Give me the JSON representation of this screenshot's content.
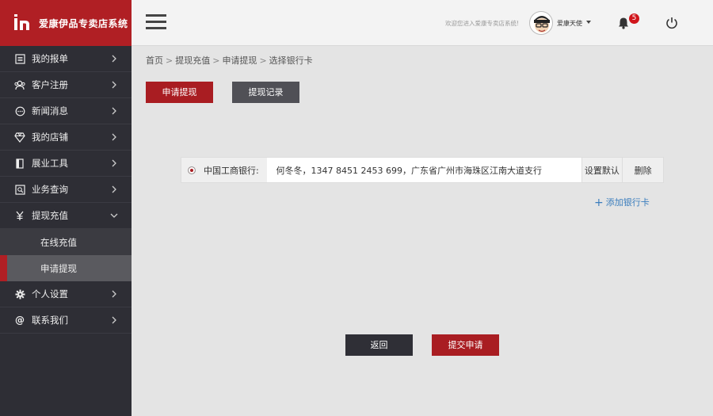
{
  "brand": {
    "name": "爱康伊品专卖店系统",
    "color": "#b01f24"
  },
  "header": {
    "welcome": "欢迎您进入爱康专卖店系统!",
    "username": "爱康天使",
    "notification_count": "5"
  },
  "sidebar": {
    "items": [
      {
        "label": "我的报单",
        "icon": "list-icon"
      },
      {
        "label": "客户注册",
        "icon": "users-icon"
      },
      {
        "label": "新闻消息",
        "icon": "message-icon"
      },
      {
        "label": "我的店铺",
        "icon": "diamond-icon"
      },
      {
        "label": "展业工具",
        "icon": "book-icon"
      },
      {
        "label": "业务查询",
        "icon": "query-icon"
      },
      {
        "label": "提现充值",
        "icon": "yuan-icon",
        "expanded": true,
        "children": [
          {
            "label": "在线充值"
          },
          {
            "label": "申请提现",
            "active": true
          }
        ]
      },
      {
        "label": "个人设置",
        "icon": "gear-icon"
      },
      {
        "label": "联系我们",
        "icon": "at-icon"
      }
    ]
  },
  "breadcrumb": [
    "首页",
    "提现充值",
    "申请提现",
    "选择银行卡"
  ],
  "tabs": {
    "apply": "申请提现",
    "records": "提现记录"
  },
  "bank_card": {
    "bank": "中国工商银行:",
    "info": "何冬冬，1347 8451 2453 699，广东省广州市海珠区江南大道支行",
    "set_default": "设置默认",
    "delete": "删除",
    "selected": true
  },
  "add_card": "添加银行卡",
  "buttons": {
    "back": "返回",
    "submit": "提交申请"
  }
}
